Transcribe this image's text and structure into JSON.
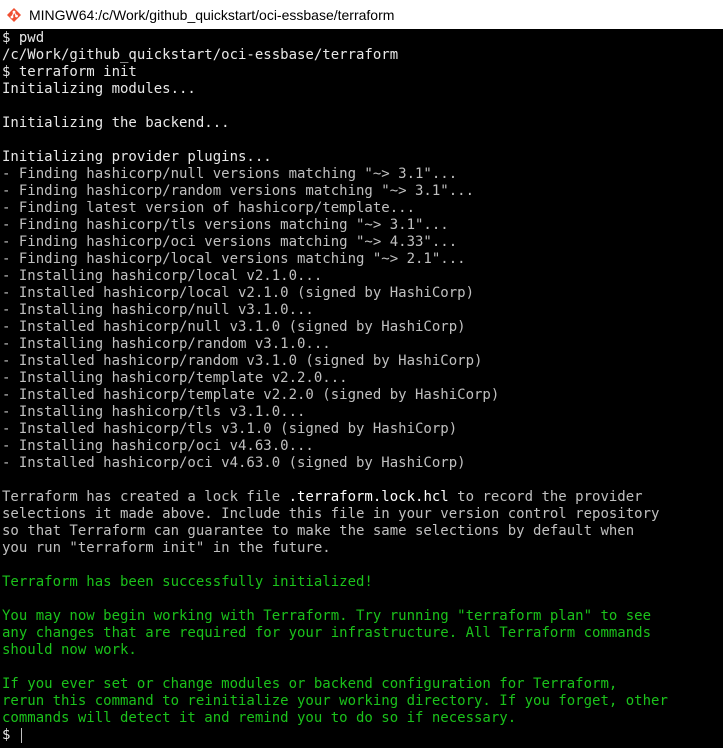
{
  "window": {
    "title": "MINGW64:/c/Work/github_quickstart/oci-essbase/terraform",
    "icon": "mingw-terminal-icon"
  },
  "terminal": {
    "background": "#000000",
    "foreground": "#c0c0c0",
    "success_color": "#1bc21b",
    "lines": [
      "$ pwd",
      "/c/Work/github_quickstart/oci-essbase/terraform",
      "$ terraform init",
      "Initializing modules...",
      "",
      "Initializing the backend...",
      "",
      "Initializing provider plugins...",
      "- Finding hashicorp/null versions matching \"~> 3.1\"...",
      "- Finding hashicorp/random versions matching \"~> 3.1\"...",
      "- Finding latest version of hashicorp/template...",
      "- Finding hashicorp/tls versions matching \"~> 3.1\"...",
      "- Finding hashicorp/oci versions matching \"~> 4.33\"...",
      "- Finding hashicorp/local versions matching \"~> 2.1\"...",
      "- Installing hashicorp/local v2.1.0...",
      "- Installed hashicorp/local v2.1.0 (signed by HashiCorp)",
      "- Installing hashicorp/null v3.1.0...",
      "- Installed hashicorp/null v3.1.0 (signed by HashiCorp)",
      "- Installing hashicorp/random v3.1.0...",
      "- Installed hashicorp/random v3.1.0 (signed by HashiCorp)",
      "- Installing hashicorp/template v2.2.0...",
      "- Installed hashicorp/template v2.2.0 (signed by HashiCorp)",
      "- Installing hashicorp/tls v3.1.0...",
      "- Installed hashicorp/tls v3.1.0 (signed by HashiCorp)",
      "- Installing hashicorp/oci v4.63.0...",
      "- Installed hashicorp/oci v4.63.0 (signed by HashiCorp)",
      "",
      "Terraform has created a lock file ",
      "selections it made above. Include this file in your version control repository",
      "so that Terraform can guarantee to make the same selections by default when",
      "you run \"terraform init\" in the future.",
      "",
      "Terraform has been successfully initialized!",
      "",
      "You may now begin working with Terraform. Try running \"terraform plan\" to see",
      "any changes that are required for your infrastructure. All Terraform commands",
      "should now work.",
      "",
      "If you ever set or change modules or backend configuration for Terraform,",
      "rerun this command to reinitialize your working directory. If you forget, other",
      "commands will detect it and remind you to do so if necessary.",
      "$ "
    ],
    "lock_file_name": ".terraform.lock.hcl",
    "lock_file_suffix": " to record the provider"
  }
}
